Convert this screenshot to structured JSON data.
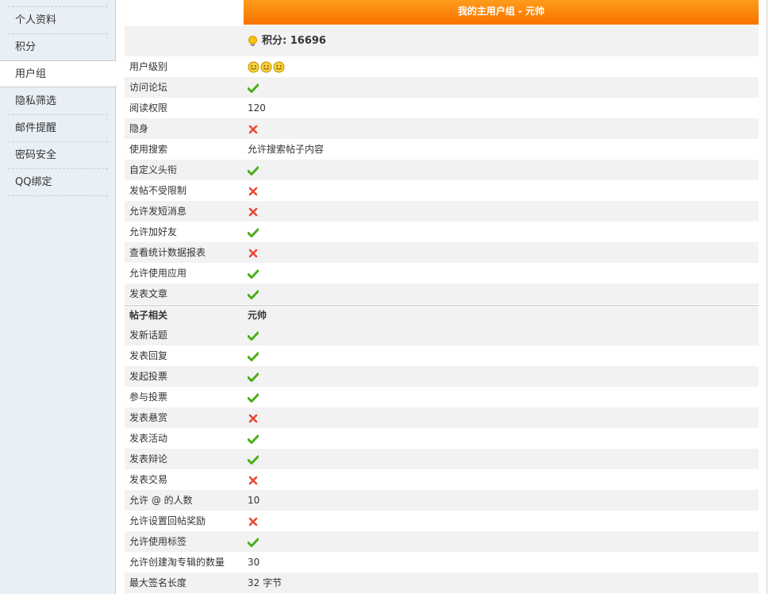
{
  "sidebar": {
    "items": [
      {
        "label": "个人资料",
        "active": false
      },
      {
        "label": "积分",
        "active": false
      },
      {
        "label": "用户组",
        "active": true
      },
      {
        "label": "隐私筛选",
        "active": false
      },
      {
        "label": "邮件提醒",
        "active": false
      },
      {
        "label": "密码安全",
        "active": false
      },
      {
        "label": "QQ绑定",
        "active": false
      }
    ]
  },
  "group": {
    "header": "我的主用户组 - 元帅",
    "score": "积分: 16696"
  },
  "rows": [
    {
      "label": "用户级别",
      "type": "stars",
      "value": "",
      "stars": 3
    },
    {
      "label": "访问论坛",
      "type": "check",
      "value": ""
    },
    {
      "label": "阅读权限",
      "type": "text",
      "value": "120"
    },
    {
      "label": "隐身",
      "type": "cross",
      "value": ""
    },
    {
      "label": "使用搜索",
      "type": "text",
      "value": "允许搜索帖子内容"
    },
    {
      "label": "自定义头衔",
      "type": "check",
      "value": ""
    },
    {
      "label": "发帖不受限制",
      "type": "cross",
      "value": ""
    },
    {
      "label": "允许发短消息",
      "type": "cross",
      "value": ""
    },
    {
      "label": "允许加好友",
      "type": "check",
      "value": ""
    },
    {
      "label": "查看统计数据报表",
      "type": "cross",
      "value": ""
    },
    {
      "label": "允许使用应用",
      "type": "check",
      "value": ""
    },
    {
      "label": "发表文章",
      "type": "check",
      "value": ""
    },
    {
      "label": "帖子相关",
      "type": "section",
      "value": "元帅"
    },
    {
      "label": "发新话题",
      "type": "check",
      "value": ""
    },
    {
      "label": "发表回复",
      "type": "check",
      "value": ""
    },
    {
      "label": "发起投票",
      "type": "check",
      "value": ""
    },
    {
      "label": "参与投票",
      "type": "check",
      "value": ""
    },
    {
      "label": "发表悬赏",
      "type": "cross",
      "value": ""
    },
    {
      "label": "发表活动",
      "type": "check",
      "value": ""
    },
    {
      "label": "发表辩论",
      "type": "check",
      "value": ""
    },
    {
      "label": "发表交易",
      "type": "cross",
      "value": ""
    },
    {
      "label": "允许 @ 的人数",
      "type": "text",
      "value": "10"
    },
    {
      "label": "允许设置回帖奖励",
      "type": "cross",
      "value": ""
    },
    {
      "label": "允许使用标签",
      "type": "check",
      "value": ""
    },
    {
      "label": "允许创建淘专辑的数量",
      "type": "text",
      "value": "30"
    },
    {
      "label": "最大签名长度",
      "type": "text",
      "value": "32 字节"
    }
  ],
  "icons": {
    "check_color": "#4bae1b",
    "cross_color": "#e8483a",
    "header_gradient": [
      "#ff9c1a",
      "#f77200"
    ]
  }
}
